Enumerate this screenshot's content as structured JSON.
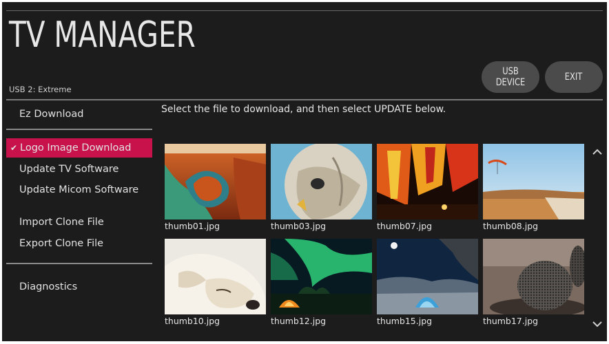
{
  "app": {
    "title": "TV MANAGER",
    "device": "USB 2: Extreme"
  },
  "header_buttons": {
    "usb_device": "USB DEVICE",
    "exit": "EXIT"
  },
  "sidebar": {
    "items": [
      {
        "label": "Ez Download",
        "active": false
      },
      {
        "label": "Logo Image Download",
        "active": true
      },
      {
        "label": "Update TV Software",
        "active": false
      },
      {
        "label": "Update Micom Software",
        "active": false
      },
      {
        "label": "Import Clone File",
        "active": false
      },
      {
        "label": "Export Clone File",
        "active": false
      },
      {
        "label": "Diagnostics",
        "active": false
      }
    ],
    "active_check": "✔"
  },
  "main": {
    "instruction": "Select the file to download, and then select UPDATE below.",
    "thumbnails": [
      {
        "file": "thumb01.jpg"
      },
      {
        "file": "thumb03.jpg"
      },
      {
        "file": "thumb07.jpg"
      },
      {
        "file": "thumb08.jpg"
      },
      {
        "file": "thumb10.jpg"
      },
      {
        "file": "thumb12.jpg"
      },
      {
        "file": "thumb15.jpg"
      },
      {
        "file": "thumb17.jpg"
      }
    ]
  },
  "colors": {
    "accent": "#c8124b",
    "background": "#1c1c1c",
    "button": "#4b4b4b"
  },
  "icons": {
    "scroll_up": "chevron-up-icon",
    "scroll_down": "chevron-down-icon",
    "check": "check-icon"
  }
}
